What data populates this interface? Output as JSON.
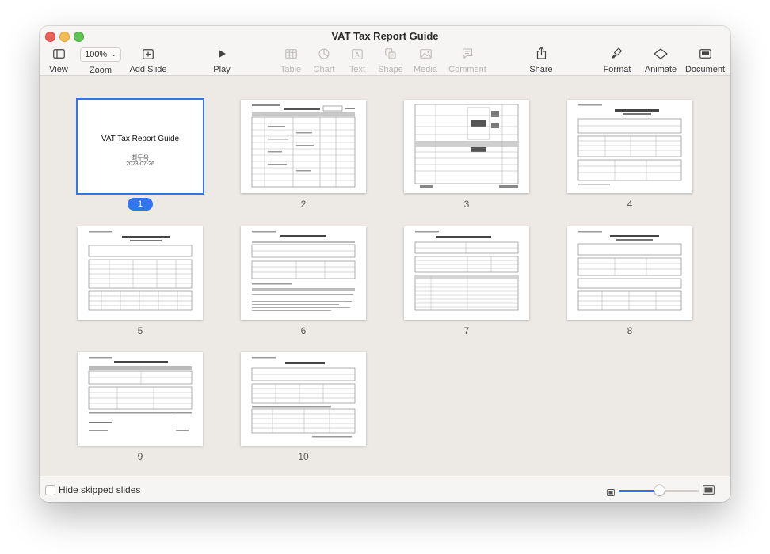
{
  "window": {
    "title": "VAT Tax Report Guide"
  },
  "toolbar": {
    "view": "View",
    "zoom_value": "100%",
    "zoom": "Zoom",
    "add_slide": "Add Slide",
    "play": "Play",
    "table": "Table",
    "chart": "Chart",
    "text": "Text",
    "shape": "Shape",
    "media": "Media",
    "comment": "Comment",
    "share": "Share",
    "format": "Format",
    "animate": "Animate",
    "document": "Document"
  },
  "cover": {
    "title": "VAT Tax Report Guide",
    "author": "최두옥",
    "date": "2023-07-26"
  },
  "slides": [
    {
      "number": "1",
      "selected": true
    },
    {
      "number": "2"
    },
    {
      "number": "3"
    },
    {
      "number": "4"
    },
    {
      "number": "5"
    },
    {
      "number": "6"
    },
    {
      "number": "7"
    },
    {
      "number": "8"
    },
    {
      "number": "9"
    },
    {
      "number": "10"
    }
  ],
  "bottombar": {
    "hide_skipped_label": "Hide skipped slides",
    "hide_skipped_checked": false,
    "thumbnail_size_fraction": 0.5
  },
  "colors": {
    "accent": "#2f76ef"
  }
}
